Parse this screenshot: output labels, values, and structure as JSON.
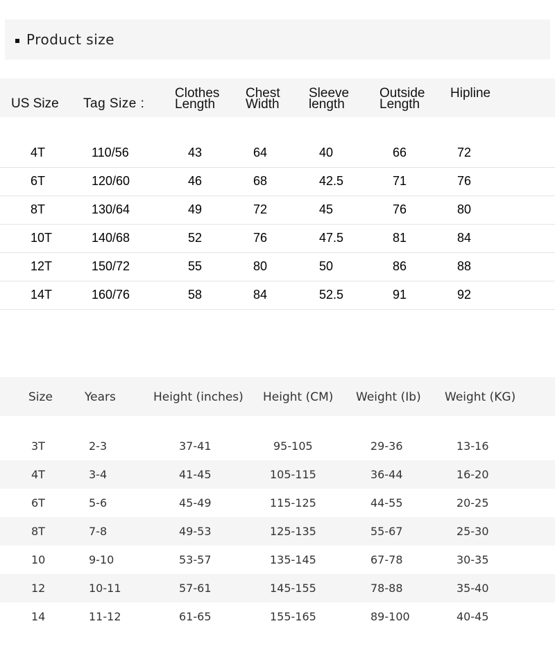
{
  "title": "Product size",
  "table1": {
    "headers": [
      [
        "US Size"
      ],
      [
        "Tag Size :"
      ],
      [
        "Clothes",
        "Length"
      ],
      [
        "Chest",
        "Width"
      ],
      [
        "Sleeve",
        "length"
      ],
      [
        "Outside",
        "Length"
      ],
      [
        "Hipline"
      ]
    ],
    "rows": [
      [
        "4T",
        "110/56",
        "43",
        "64",
        "40",
        "66",
        "72"
      ],
      [
        "6T",
        "120/60",
        "46",
        "68",
        "42.5",
        "71",
        "76"
      ],
      [
        "8T",
        "130/64",
        "49",
        "72",
        "45",
        "76",
        "80"
      ],
      [
        "10T",
        "140/68",
        "52",
        "76",
        "47.5",
        "81",
        "84"
      ],
      [
        "12T",
        "150/72",
        "55",
        "80",
        "50",
        "86",
        "88"
      ],
      [
        "14T",
        "160/76",
        "58",
        "84",
        "52.5",
        "91",
        "92"
      ]
    ]
  },
  "table2": {
    "headers": [
      "Size",
      "Years",
      "Height (inches)",
      "Height (CM)",
      "Weight (Ib)",
      "Weight (KG)"
    ],
    "rows": [
      [
        "3T",
        "2-3",
        "37-41",
        "95-105",
        "29-36",
        "13-16"
      ],
      [
        "4T",
        "3-4",
        "41-45",
        "105-115",
        "36-44",
        "16-20"
      ],
      [
        "6T",
        "5-6",
        "45-49",
        "115-125",
        "44-55",
        "20-25"
      ],
      [
        "8T",
        "7-8",
        "49-53",
        "125-135",
        "55-67",
        "25-30"
      ],
      [
        "10",
        "9-10",
        "53-57",
        "135-145",
        "67-78",
        "30-35"
      ],
      [
        "12",
        "10-11",
        "57-61",
        "145-155",
        "78-88",
        "35-40"
      ],
      [
        "14",
        "11-12",
        "61-65",
        "155-165",
        "89-100",
        "40-45"
      ]
    ]
  }
}
